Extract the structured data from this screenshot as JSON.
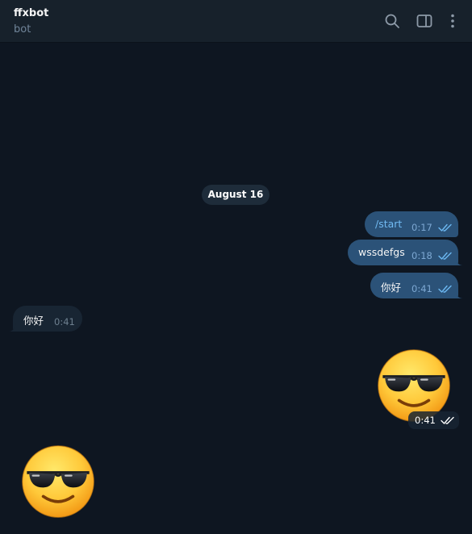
{
  "header": {
    "title": "ffxbot",
    "subtitle": "bot"
  },
  "date_divider": "August 16",
  "messages": [
    {
      "text": "/start",
      "time": "0:17",
      "direction": "out",
      "status": "read"
    },
    {
      "text": "wssdefgs",
      "time": "0:18",
      "direction": "out",
      "status": "read"
    },
    {
      "text": "你好",
      "time": "0:41",
      "direction": "out",
      "status": "read"
    },
    {
      "text": "你好",
      "time": "0:41",
      "direction": "in"
    }
  ],
  "stickers": [
    {
      "emoji": "smiling-face-with-sunglasses",
      "direction": "out",
      "time": "0:41",
      "status": "read"
    },
    {
      "emoji": "smiling-face-with-sunglasses",
      "direction": "in"
    }
  ],
  "icons": [
    "search-icon",
    "sidebar-toggle-icon",
    "more-vertical-icon",
    "double-check-icon"
  ],
  "colors": {
    "background": "#0e1621",
    "header": "#17212b",
    "outgoing_bubble": "#2b5278",
    "incoming_bubble": "#182533",
    "accent": "#71baf2"
  }
}
